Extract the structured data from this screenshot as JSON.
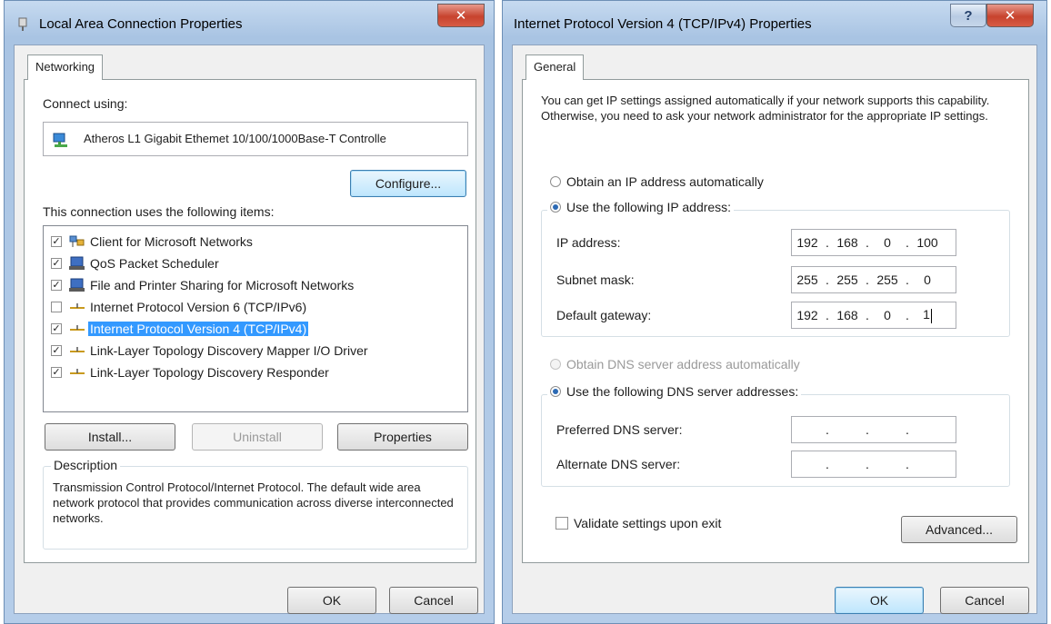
{
  "colors": {
    "title_gradient_top": "#c6daf0",
    "close_button": "#c7432e",
    "selection": "#3399ff",
    "radio_dot": "#2d6ab4"
  },
  "left_dialog": {
    "title": "Local Area Connection Properties",
    "tab": "Networking",
    "connect_using_label": "Connect using:",
    "adapter_name": "Atheros L1 Gigabit Ethemet 10/100/1000Base-T Controlle",
    "configure_button": "Configure...",
    "items_label": "This connection uses the following items:",
    "items": [
      {
        "label": "Client for Microsoft Networks",
        "checked": true,
        "icon": "network-client-icon"
      },
      {
        "label": "QoS Packet Scheduler",
        "checked": true,
        "icon": "network-service-icon"
      },
      {
        "label": "File and Printer Sharing for Microsoft Networks",
        "checked": true,
        "icon": "network-service-icon"
      },
      {
        "label": "Internet Protocol Version 6 (TCP/IPv6)",
        "checked": false,
        "icon": "protocol-icon"
      },
      {
        "label": "Internet Protocol Version 4 (TCP/IPv4)",
        "checked": true,
        "icon": "protocol-icon",
        "selected": true
      },
      {
        "label": "Link-Layer Topology Discovery Mapper I/O Driver",
        "checked": true,
        "icon": "protocol-icon"
      },
      {
        "label": "Link-Layer Topology Discovery Responder",
        "checked": true,
        "icon": "protocol-icon"
      }
    ],
    "install_button": "Install...",
    "uninstall_button": "Uninstall",
    "properties_button": "Properties",
    "description_label": "Description",
    "description_text": "Transmission Control Protocol/Internet Protocol. The default wide area network protocol that provides communication across diverse interconnected networks.",
    "ok_button": "OK",
    "cancel_button": "Cancel"
  },
  "right_dialog": {
    "title": "Internet Protocol Version 4 (TCP/IPv4) Properties",
    "help_button": "?",
    "tab": "General",
    "intro_text": "You can get IP settings assigned automatically if your network supports this capability. Otherwise, you need to ask your network administrator for the appropriate IP settings.",
    "obtain_ip_auto": "Obtain an IP address automatically",
    "use_following_ip": "Use the following IP address:",
    "ip_address_label": "IP address:",
    "ip_address": [
      "192",
      "168",
      "0",
      "100"
    ],
    "subnet_mask_label": "Subnet mask:",
    "subnet_mask": [
      "255",
      "255",
      "255",
      "0"
    ],
    "default_gateway_label": "Default gateway:",
    "default_gateway": [
      "192",
      "168",
      "0",
      "1"
    ],
    "obtain_dns_auto": "Obtain DNS server address automatically",
    "use_following_dns": "Use the following DNS server addresses:",
    "preferred_dns_label": "Preferred DNS server:",
    "alternate_dns_label": "Alternate DNS server:",
    "validate_label": "Validate settings upon exit",
    "advanced_button": "Advanced...",
    "ok_button": "OK",
    "cancel_button": "Cancel"
  }
}
